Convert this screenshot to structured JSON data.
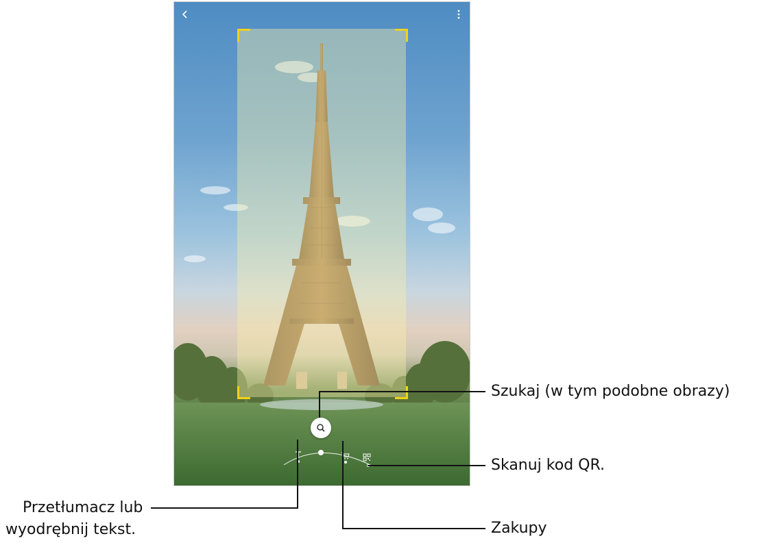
{
  "toolbar": {
    "back_icon": "chevron-left-icon",
    "more_icon": "more-vertical-icon"
  },
  "actions": {
    "search_icon": "search-icon",
    "translate_icon": "text-T-icon",
    "shopping_icon": "shopping-cart-icon",
    "qr_icon": "qr-code-icon"
  },
  "callouts": {
    "search": "Szukaj (w tym podobne obrazy)",
    "qr": "Skanuj kod QR.",
    "shopping": "Zakupy",
    "translate_line1": "Przetłumacz lub",
    "translate_line2": "wyodrębnij tekst."
  },
  "colors": {
    "frame_corners": "#f2d21b",
    "callout_line": "#111111",
    "icon": "#ffffff"
  }
}
